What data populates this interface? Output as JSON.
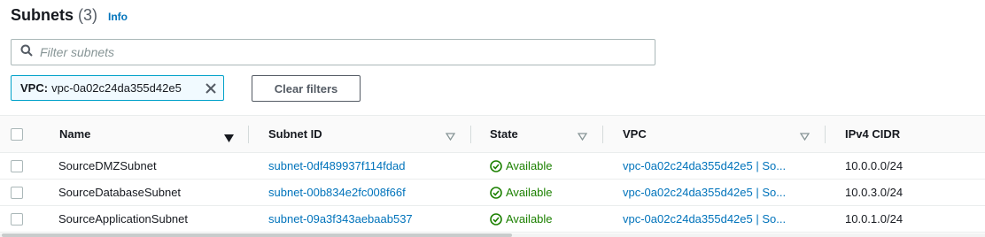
{
  "header": {
    "title": "Subnets",
    "count": "(3)",
    "info": "Info"
  },
  "search": {
    "placeholder": "Filter subnets",
    "value": ""
  },
  "filter_token": {
    "key": "VPC:",
    "value": "vpc-0a02c24da355d42e5"
  },
  "clear_filters_label": "Clear filters",
  "columns": [
    "Name",
    "Subnet ID",
    "State",
    "VPC",
    "IPv4 CIDR"
  ],
  "rows": [
    {
      "name": "SourceDMZSubnet",
      "subnet_id": "subnet-0df489937f114fdad",
      "state": "Available",
      "vpc": "vpc-0a02c24da355d42e5 | So...",
      "cidr": "10.0.0.0/24"
    },
    {
      "name": "SourceDatabaseSubnet",
      "subnet_id": "subnet-00b834e2fc008f66f",
      "state": "Available",
      "vpc": "vpc-0a02c24da355d42e5 | So...",
      "cidr": "10.0.3.0/24"
    },
    {
      "name": "SourceApplicationSubnet",
      "subnet_id": "subnet-09a3f343aebaab537",
      "state": "Available",
      "vpc": "vpc-0a02c24da355d42e5 | So...",
      "cidr": "10.0.1.0/24"
    }
  ],
  "icons": {
    "search": "search-icon",
    "close": "close-icon",
    "sort_active": "sort-descending-icon",
    "sort": "sort-icon",
    "status": "check-circle-icon"
  },
  "colors": {
    "link": "#0073bb",
    "available": "#1d8102",
    "token_border": "#00a1c9"
  }
}
